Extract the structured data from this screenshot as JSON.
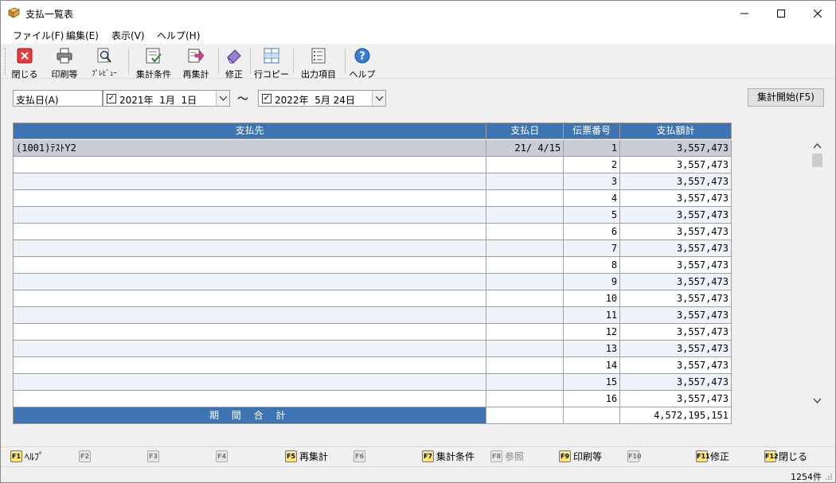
{
  "window": {
    "title": "支払一覧表",
    "icon": "ledger-book-icon",
    "controls": {
      "minimize": "minimize-icon",
      "maximize": "maximize-icon",
      "close": "close-icon"
    }
  },
  "menu": [
    {
      "label": "ファイル(F)"
    },
    {
      "label": "編集(E)"
    },
    {
      "label": "表示(V)"
    },
    {
      "label": "ヘルプ(H)"
    }
  ],
  "toolbar": [
    {
      "label": "閉じる",
      "icon": "close-x-icon"
    },
    {
      "label": "印刷等",
      "icon": "printer-icon"
    },
    {
      "label": "ﾌﾟﾚﾋﾞｭｰ",
      "icon": "magnifier-icon"
    },
    {
      "label": "集計条件",
      "icon": "checklist-icon"
    },
    {
      "label": "再集計",
      "icon": "arrow-recalc-icon"
    },
    {
      "label": "修正",
      "icon": "eraser-icon"
    },
    {
      "label": "行コピー",
      "icon": "row-copy-icon"
    },
    {
      "label": "出力項目",
      "icon": "output-list-icon"
    },
    {
      "label": "ヘルプ",
      "icon": "help-icon"
    }
  ],
  "filter": {
    "date_type": "支払日(A)",
    "from": {
      "checked": true,
      "year": "2021年",
      "month": "1月",
      "day": "1日"
    },
    "separator": "～",
    "to": {
      "checked": true,
      "year": "2022年",
      "month": "5月",
      "day": "24日"
    },
    "start_button": "集計開始(F5)"
  },
  "table": {
    "headers": [
      "支払先",
      "支払日",
      "伝票番号",
      "支払額計"
    ],
    "rows": [
      {
        "payee": "(1001)ﾃｽﾄY2",
        "date": "21/ 4/15",
        "voucher": "1",
        "amount": "3,557,473"
      },
      {
        "payee": "",
        "date": "",
        "voucher": "2",
        "amount": "3,557,473"
      },
      {
        "payee": "",
        "date": "",
        "voucher": "3",
        "amount": "3,557,473"
      },
      {
        "payee": "",
        "date": "",
        "voucher": "4",
        "amount": "3,557,473"
      },
      {
        "payee": "",
        "date": "",
        "voucher": "5",
        "amount": "3,557,473"
      },
      {
        "payee": "",
        "date": "",
        "voucher": "6",
        "amount": "3,557,473"
      },
      {
        "payee": "",
        "date": "",
        "voucher": "7",
        "amount": "3,557,473"
      },
      {
        "payee": "",
        "date": "",
        "voucher": "8",
        "amount": "3,557,473"
      },
      {
        "payee": "",
        "date": "",
        "voucher": "9",
        "amount": "3,557,473"
      },
      {
        "payee": "",
        "date": "",
        "voucher": "10",
        "amount": "3,557,473"
      },
      {
        "payee": "",
        "date": "",
        "voucher": "11",
        "amount": "3,557,473"
      },
      {
        "payee": "",
        "date": "",
        "voucher": "12",
        "amount": "3,557,473"
      },
      {
        "payee": "",
        "date": "",
        "voucher": "13",
        "amount": "3,557,473"
      },
      {
        "payee": "",
        "date": "",
        "voucher": "14",
        "amount": "3,557,473"
      },
      {
        "payee": "",
        "date": "",
        "voucher": "15",
        "amount": "3,557,473"
      },
      {
        "payee": "",
        "date": "",
        "voucher": "16",
        "amount": "3,557,473"
      }
    ],
    "total": {
      "label": "期 間 合 計",
      "date": "",
      "voucher": "",
      "amount": "4,572,195,151"
    }
  },
  "fkeys": [
    {
      "key": "F1",
      "label": "ﾍﾙﾌﾟ",
      "enabled": true
    },
    {
      "key": "F2",
      "label": "",
      "enabled": false
    },
    {
      "key": "F3",
      "label": "",
      "enabled": false
    },
    {
      "key": "F4",
      "label": "",
      "enabled": false
    },
    {
      "key": "F5",
      "label": "再集計",
      "enabled": true
    },
    {
      "key": "F6",
      "label": "",
      "enabled": false
    },
    {
      "key": "F7",
      "label": "集計条件",
      "enabled": true
    },
    {
      "key": "F8",
      "label": "参照",
      "enabled": false
    },
    {
      "key": "F9",
      "label": "印刷等",
      "enabled": true
    },
    {
      "key": "F10",
      "label": "",
      "enabled": false
    },
    {
      "key": "F11",
      "label": "修正",
      "enabled": true
    },
    {
      "key": "F12",
      "label": "閉じる",
      "enabled": true
    }
  ],
  "status": {
    "count": "1254件"
  }
}
